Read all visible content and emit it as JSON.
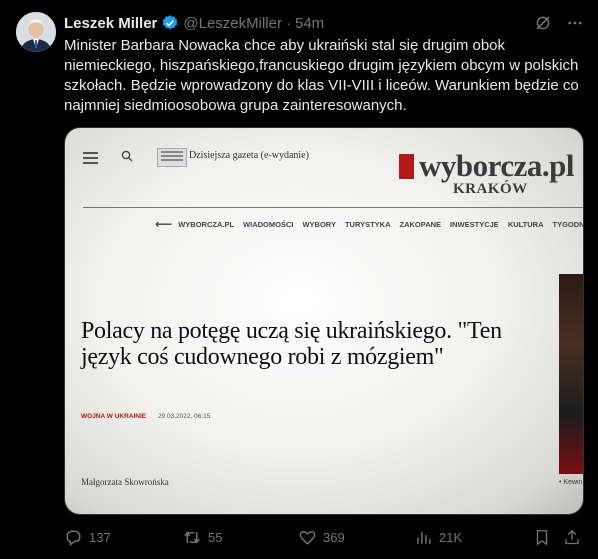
{
  "author": {
    "name": "Leszek Miller",
    "handle": "@LeszekMiller",
    "time": "54m",
    "verified_color": "#1d9bf0"
  },
  "tweet_text": "Minister Barbara Nowacka chce aby ukraiński stal się drugim obok niemieckiego, hiszpańskiego,francuskiego drugim językiem obcym w polskich szkołach. Będzie wprowadzony do klas VII-VIII i liceów. Warunkiem będzie co najmniej siedmioosobowa grupa zainteresowanych.",
  "media": {
    "eedition": "Dzisiejsza gazeta (e-wydanie)",
    "logo": "wyborcza.pl",
    "city": "KRAKÓW",
    "nav": [
      "WYBORCZA.PL",
      "WIADOMOŚCI",
      "WYBORY",
      "TURYSTYKA",
      "ZAKOPANE",
      "INWESTYCJE",
      "KULTURA",
      "TYGODNIK KRAKOWSKI"
    ],
    "headline": "Polacy na potęgę uczą się ukraińskiego. \"Ten język coś cudownego robi z mózgiem\"",
    "category": "WOJNA W UKRAINIE",
    "date": "29.03.2022, 06:15",
    "article_author": "Małgorzata Skowrońska",
    "side_caption": "• Kewin"
  },
  "actions": {
    "replies": "137",
    "retweets": "55",
    "likes": "369",
    "views": "21K"
  },
  "colors": {
    "background": "#000000",
    "text": "#e7e9ea",
    "muted": "#71767b",
    "brand_red": "#b3181b"
  }
}
